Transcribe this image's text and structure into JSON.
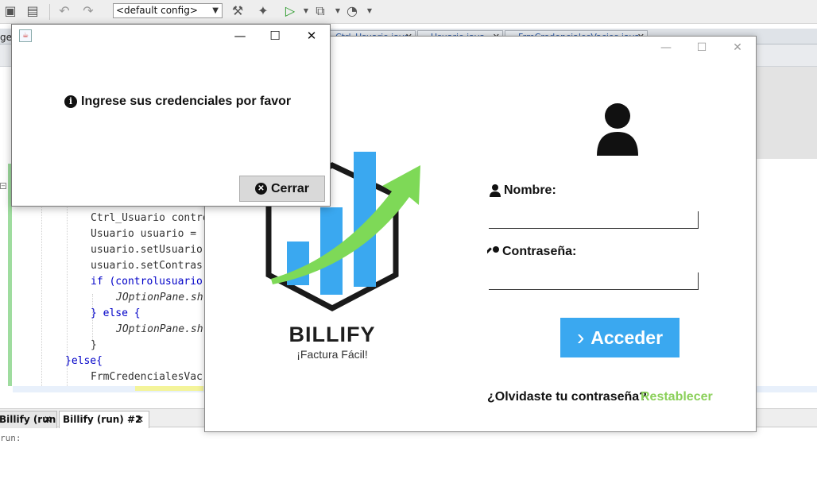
{
  "ide": {
    "config_combo": "<default config>",
    "editor_tabs": [
      "Ctrl_Usuario.java",
      "Usuario.java",
      "FrmCredencialesVacios.java"
    ],
    "left_stub_label": "ge",
    "code_lines": [
      "Ctrl_Usuario contro",
      "Usuario usuario = ",
      "usuario.setUsuario",
      "usuario.setContras",
      "if (controlusuario",
      "JOptionPane.sh",
      "} else {",
      "JOptionPane.sh",
      "}",
      "}else{",
      "FrmCredencialesVac"
    ],
    "output_tabs": [
      "Billify (run)",
      "Billify (run) #2"
    ],
    "output_text": "run:"
  },
  "login": {
    "brand_name": "BILLIFY",
    "brand_tagline": "¡Factura Fácil!",
    "nombre_label": "Nombre:",
    "password_label": "Contraseña:",
    "nombre_value": "",
    "password_value": "",
    "acceder_label": "Acceder",
    "forgot_text": "¿Olvidaste tu contraseña?",
    "restablecer_label": "Restablecer",
    "colors": {
      "accent_blue": "#3aa8f0",
      "accent_green": "#8bd05a"
    }
  },
  "dialog": {
    "message": "Ingrese sus credenciales por favor",
    "close_button": "Cerrar"
  }
}
